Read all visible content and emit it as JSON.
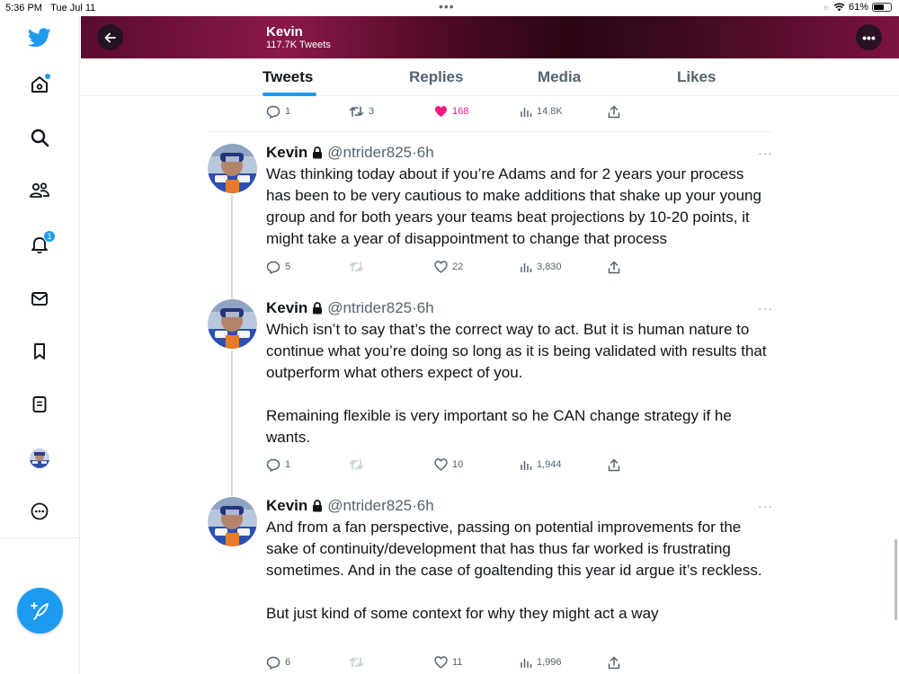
{
  "status_bar": {
    "time": "5:36 PM",
    "date": "Tue Jul 11",
    "battery": "61%",
    "battery_level": 0.61,
    "dots": "•••"
  },
  "header": {
    "name": "Kevin",
    "tweet_count": "117.7K Tweets",
    "more": "•••"
  },
  "tabs": [
    {
      "label": "Tweets",
      "active": true
    },
    {
      "label": "Replies",
      "active": false
    },
    {
      "label": "Media",
      "active": false
    },
    {
      "label": "Likes",
      "active": false
    }
  ],
  "sidebar": {
    "notifications_badge": "1"
  },
  "top_actions": {
    "replies": "1",
    "retweets": "3",
    "likes": "168",
    "views": "14.8K"
  },
  "tweets": [
    {
      "name": "Kevin",
      "handle": "@ntrider825",
      "time": "·6h",
      "more": "···",
      "paragraphs": [
        "Was thinking today about if you’re Adams and for 2 years your process has been to be very cautious to make additions that shake up your young group and for both years your teams beat projections by 10-20 points, it might take a year of disappointment to change that process"
      ],
      "actions": {
        "replies": "5",
        "retweets": "",
        "likes": "22",
        "views": "3,830"
      }
    },
    {
      "name": "Kevin",
      "handle": "@ntrider825",
      "time": "·6h",
      "more": "···",
      "paragraphs": [
        "Which isn’t to say that’s the correct way to act. But it is human nature to continue what you’re doing so long as it is being validated with results that outperform what others expect of you.",
        "Remaining flexible is very important so he CAN change strategy if he wants."
      ],
      "actions": {
        "replies": "1",
        "retweets": "",
        "likes": "10",
        "views": "1,944"
      }
    },
    {
      "name": "Kevin",
      "handle": "@ntrider825",
      "time": "·6h",
      "more": "···",
      "paragraphs": [
        "And from a fan perspective, passing on potential improvements for the sake of continuity/development that has thus far worked is frustrating sometimes. And in the case of goaltending this year id argue it’s reckless.",
        "But just kind of some context for why they might act a way"
      ],
      "actions": {
        "replies": "6",
        "retweets": "",
        "likes": "11",
        "views": "1,996"
      }
    }
  ],
  "colors": {
    "accent": "#1d9bf0",
    "like": "#f91880",
    "banner": "#7c1240"
  }
}
